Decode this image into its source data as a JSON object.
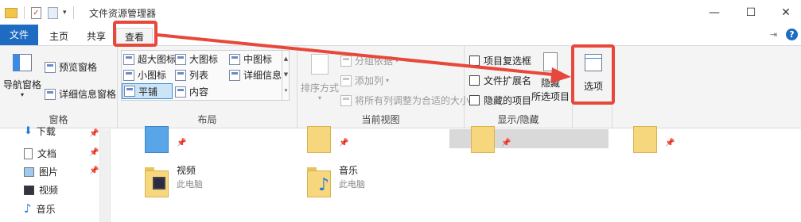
{
  "window": {
    "title": "文件资源管理器",
    "controls": {
      "minimize": "—",
      "maximize": "☐",
      "close": "✕"
    }
  },
  "tabs": [
    {
      "label": "文件"
    },
    {
      "label": "主页"
    },
    {
      "label": "共享"
    },
    {
      "label": "查看"
    }
  ],
  "ribbon": {
    "pane_group": {
      "nav_pane": "导航窗格",
      "preview_pane": "预览窗格",
      "details_pane": "详细信息窗格",
      "label": "窗格"
    },
    "layout_group": {
      "items": [
        "超大图标",
        "大图标",
        "中图标",
        "小图标",
        "列表",
        "详细信息",
        "平铺",
        "内容"
      ],
      "label": "布局"
    },
    "current_view_group": {
      "sort_by": "排序方式",
      "group_by": "分组依据",
      "add_column": "添加列",
      "fit_columns": "将所有列调整为合适的大小",
      "label": "当前视图"
    },
    "show_hide_group": {
      "item_checkboxes": "项目复选框",
      "file_extensions": "文件扩展名",
      "hidden_items": "隐藏的项目",
      "hide_selected_line1": "隐藏",
      "hide_selected_line2": "所选项目",
      "label": "显示/隐藏"
    },
    "options_label": "选项"
  },
  "nav": {
    "items": [
      {
        "label": "下载"
      },
      {
        "label": "文档"
      },
      {
        "label": "图片"
      },
      {
        "label": "视频"
      },
      {
        "label": "音乐"
      }
    ]
  },
  "folders": [
    {
      "name": "视频",
      "sub": "此电脑"
    },
    {
      "name": "音乐",
      "sub": "此电脑"
    }
  ],
  "colors": {
    "accent": "#1e6cc2",
    "annotation": "#e8473c",
    "folder": "#f7d77e"
  }
}
